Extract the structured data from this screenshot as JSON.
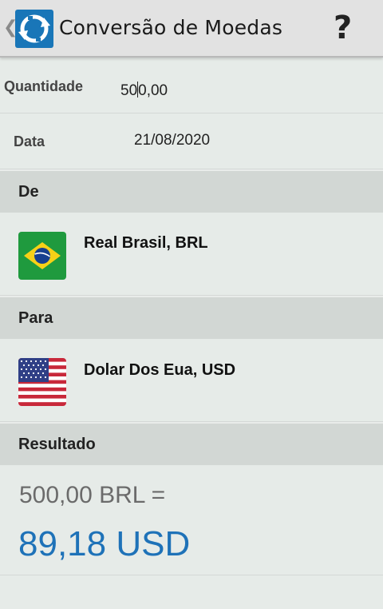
{
  "appbar": {
    "title": "Conversão de Moedas",
    "back_icon": "chevron-left-icon",
    "app_icon": "currency-exchange-icon",
    "help_icon": "?"
  },
  "form": {
    "quantity_label": "Quantidade",
    "quantity_value_before_cursor": "50",
    "quantity_value_after_cursor": "0,00",
    "date_label": "Data",
    "date_value": "21/08/2020"
  },
  "from": {
    "header": "De",
    "currency": "Real Brasil, BRL",
    "flag_icon": "brazil-flag-icon"
  },
  "to": {
    "header": "Para",
    "currency": "Dolar Dos Eua, USD",
    "flag_icon": "usa-flag-icon"
  },
  "result": {
    "header": "Resultado",
    "input_line": "500,00 BRL =",
    "output_line": "89,18 USD"
  },
  "colors": {
    "accent_blue": "#1e72b8",
    "section_header_bg": "#d2d7d4",
    "background": "#e6ebe8"
  }
}
